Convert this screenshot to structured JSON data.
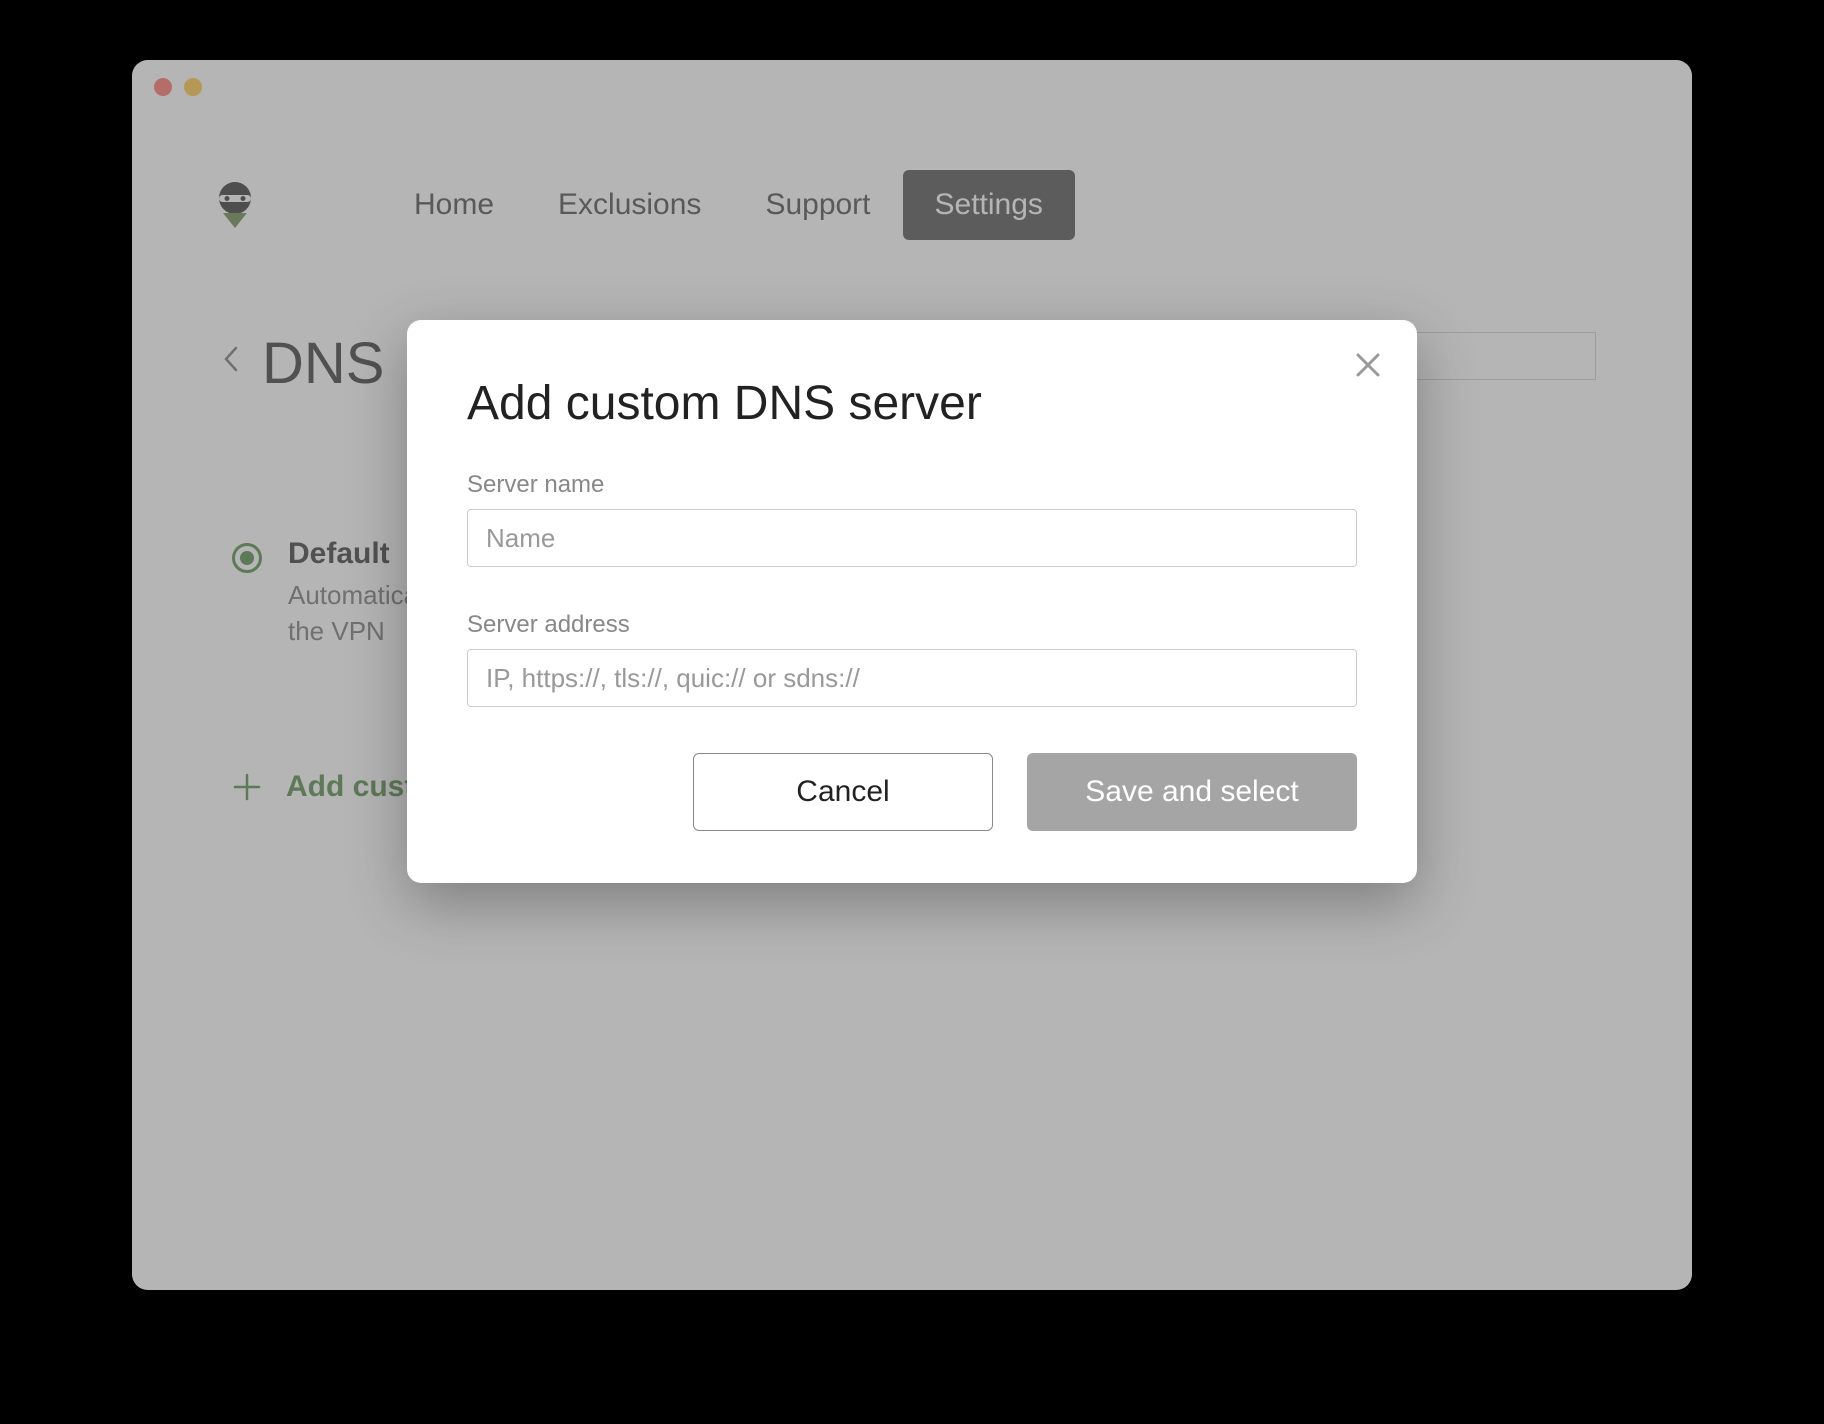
{
  "nav": {
    "items": [
      {
        "label": "Home"
      },
      {
        "label": "Exclusions"
      },
      {
        "label": "Support"
      },
      {
        "label": "Settings"
      }
    ],
    "active_index": 3
  },
  "page": {
    "title": "DNS"
  },
  "default_option": {
    "title": "Default",
    "description": "Automatica the VPN"
  },
  "add_custom_row": {
    "label": "Add cust"
  },
  "modal": {
    "title": "Add custom DNS server",
    "server_name_label": "Server name",
    "server_name_placeholder": "Name",
    "server_name_value": "",
    "server_address_label": "Server address",
    "server_address_placeholder": "IP, https://, tls://, quic:// or sdns://",
    "server_address_value": "",
    "cancel_label": "Cancel",
    "save_label": "Save and select"
  },
  "colors": {
    "accent_green": "#3f7a2f",
    "nav_active_bg": "#3a3a3a",
    "primary_disabled": "#a5a5a5"
  }
}
